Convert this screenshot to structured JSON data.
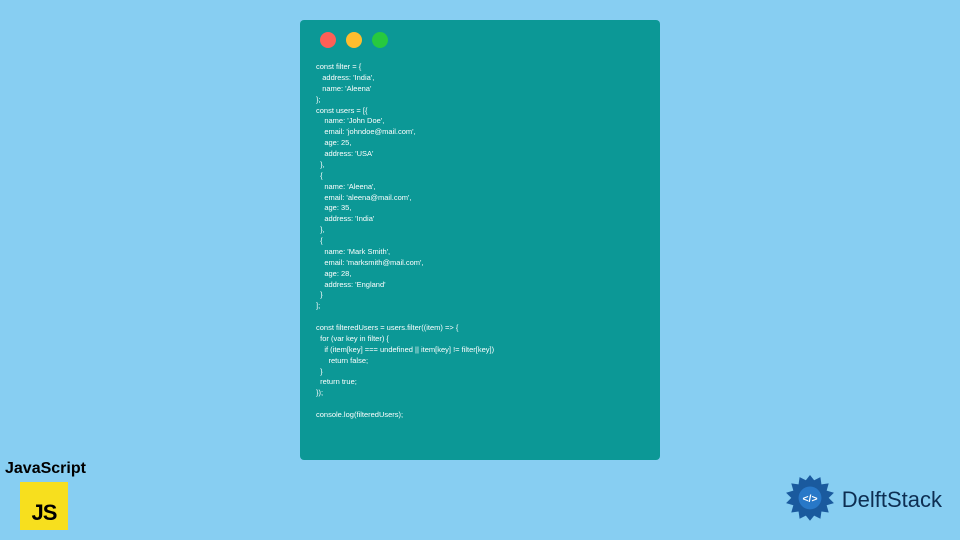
{
  "codeWindow": {
    "lines": [
      "const filter = {",
      "   address: 'India',",
      "   name: 'Aleena'",
      "};",
      "const users = [{",
      "    name: 'John Doe',",
      "    email: 'johndoe@mail.com',",
      "    age: 25,",
      "    address: 'USA'",
      "  },",
      "  {",
      "    name: 'Aleena',",
      "    email: 'aleena@mail.com',",
      "    age: 35,",
      "    address: 'India'",
      "  },",
      "  {",
      "    name: 'Mark Smith',",
      "    email: 'marksmith@mail.com',",
      "    age: 28,",
      "    address: 'England'",
      "  }",
      "];",
      "",
      "const filteredUsers = users.filter((item) => {",
      "  for (var key in filter) {",
      "    if (item[key] === undefined || item[key] != filter[key])",
      "      return false;",
      "  }",
      "  return true;",
      "});",
      "",
      "console.log(filteredUsers);"
    ]
  },
  "jsLabel": "JavaScript",
  "jsLogoText": "JS",
  "brand": "DelftStack"
}
